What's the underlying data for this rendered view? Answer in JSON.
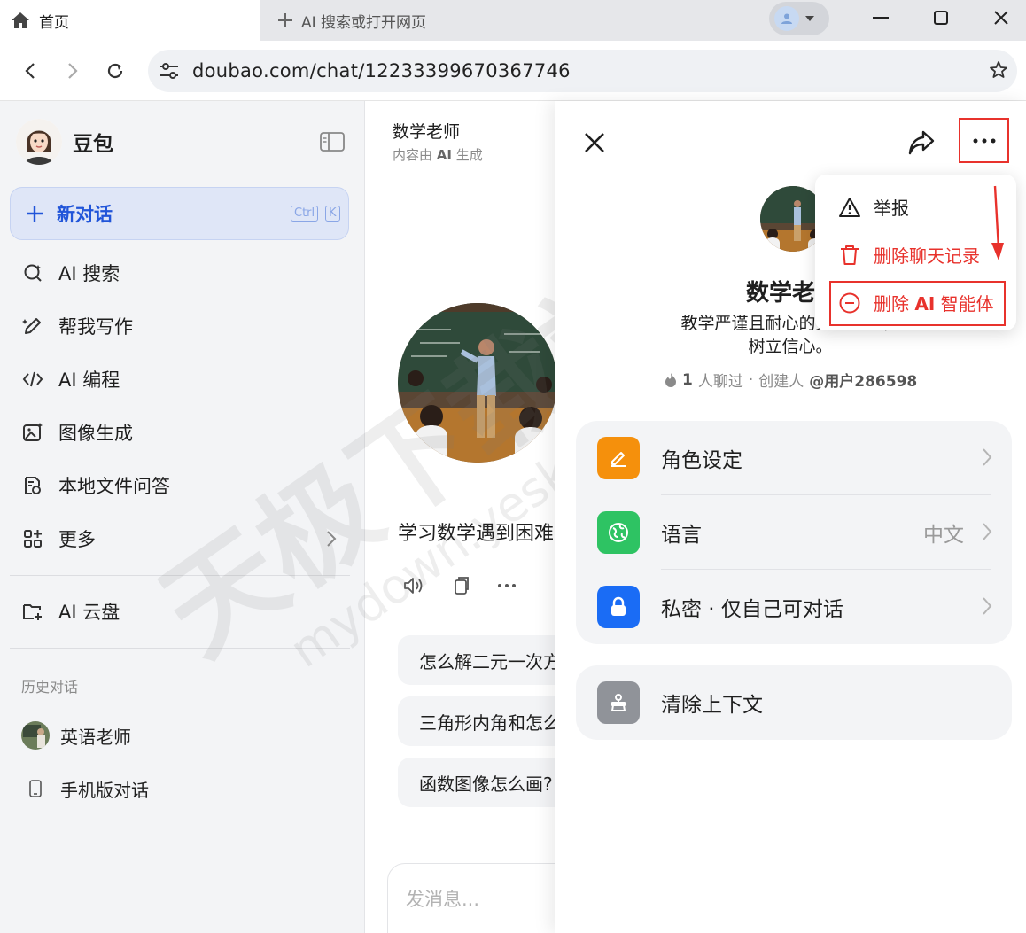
{
  "browser": {
    "active_tab": "首页",
    "new_tab": "AI 搜索或打开网页",
    "url": "doubao.com/chat/12233399670367746"
  },
  "sidebar": {
    "brand": "豆包",
    "new_chat": {
      "label": "新对话",
      "shortcut_1": "Ctrl",
      "shortcut_2": "K"
    },
    "items": [
      {
        "label": "AI 搜索",
        "icon": "search-ai-icon"
      },
      {
        "label": "帮我写作",
        "icon": "pen-icon"
      },
      {
        "label": "AI 编程",
        "icon": "code-icon"
      },
      {
        "label": "图像生成",
        "icon": "image-icon"
      },
      {
        "label": "本地文件问答",
        "icon": "file-icon"
      },
      {
        "label": "更多",
        "icon": "grid-icon"
      }
    ],
    "cloud": "AI 云盘",
    "history_title": "历史对话",
    "history": [
      {
        "label": "英语老师"
      },
      {
        "label": "手机版对话"
      }
    ]
  },
  "chat": {
    "title": "数学老师",
    "subtitle_prefix": "内容由",
    "subtitle_ai": "AI",
    "subtitle_suffix": "生成",
    "intro": "学习数学遇到困难",
    "suggestions": [
      "怎么解二元一次方",
      "三角形内角和怎么",
      "函数图像怎么画?"
    ],
    "composer_placeholder": "发消息..."
  },
  "panel": {
    "agent_name": "数学老",
    "desc_line1": "教学严谨且耐心的数学老师，",
    "desc_line2": "树立信心。",
    "meta_count": "1",
    "meta_chatted": "人聊过",
    "meta_sep": "·",
    "meta_creator_label": "创建人",
    "meta_creator": "@用户286598",
    "settings": [
      {
        "label": "角色设定",
        "value": "",
        "color": "#f5900c",
        "icon": "edit-icon"
      },
      {
        "label": "语言",
        "value": "中文",
        "color": "#2ec363",
        "icon": "globe-icon"
      },
      {
        "label": "私密 · 仅自己可对话",
        "value": "",
        "color": "#1a6cf5",
        "icon": "lock-icon"
      }
    ],
    "clear_context": "清除上下文"
  },
  "menu": {
    "report": "举报",
    "delete_history": "删除聊天记录",
    "delete_agent_prefix": "删除",
    "delete_agent_ai": "AI",
    "delete_agent_suffix": "智能体"
  },
  "watermark": {
    "line1": "天极下载站",
    "line2": "mydown.yesky.com"
  },
  "colors": {
    "accent": "#2155d9",
    "danger": "#e8322c"
  }
}
